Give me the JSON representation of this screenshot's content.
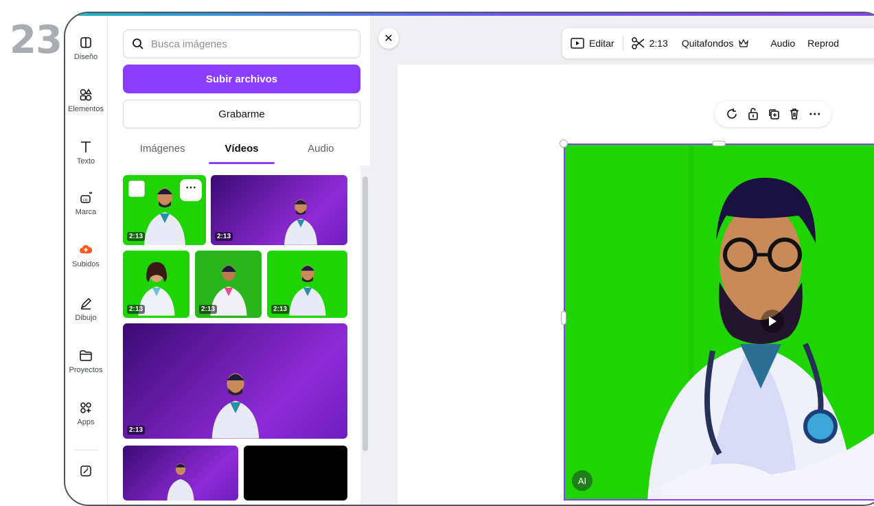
{
  "step_number": "23",
  "rail": {
    "items": [
      {
        "label": "Diseño",
        "icon": "layout-icon"
      },
      {
        "label": "Elementos",
        "icon": "shapes-icon"
      },
      {
        "label": "Texto",
        "icon": "text-icon"
      },
      {
        "label": "Marca",
        "icon": "brand-kit-icon"
      },
      {
        "label": "Subidos",
        "icon": "upload-cloud-icon"
      },
      {
        "label": "Dibujo",
        "icon": "draw-icon"
      },
      {
        "label": "Proyectos",
        "icon": "folder-icon"
      },
      {
        "label": "Apps",
        "icon": "apps-icon"
      }
    ]
  },
  "panel": {
    "search_placeholder": "Busca imágenes",
    "upload_label": "Subir archivos",
    "record_label": "Grabarme",
    "tabs": [
      "Imágenes",
      "Vídeos",
      "Audio"
    ],
    "active_tab": "Vídeos",
    "thumbnails": [
      {
        "duration": "2:13",
        "bg": "green"
      },
      {
        "duration": "2:13",
        "bg": "purple"
      },
      {
        "duration": "2:13",
        "bg": "green"
      },
      {
        "duration": "2:13",
        "bg": "green"
      },
      {
        "duration": "2:13",
        "bg": "green"
      },
      {
        "duration": "2:13",
        "bg": "purple"
      },
      {
        "duration": "",
        "bg": "purple"
      },
      {
        "duration": "",
        "bg": "black"
      }
    ]
  },
  "toolbar": {
    "edit_label": "Editar",
    "trim_label": "2:13",
    "bg_remover_label": "Quitafondos",
    "audio_label": "Audio",
    "playback_label": "Reprod"
  },
  "canvas": {
    "ai_badge": "AI"
  },
  "colors": {
    "accent": "#8b3dff",
    "green_screen": "#1fd400",
    "upload_orange": "#ff5c1a"
  }
}
